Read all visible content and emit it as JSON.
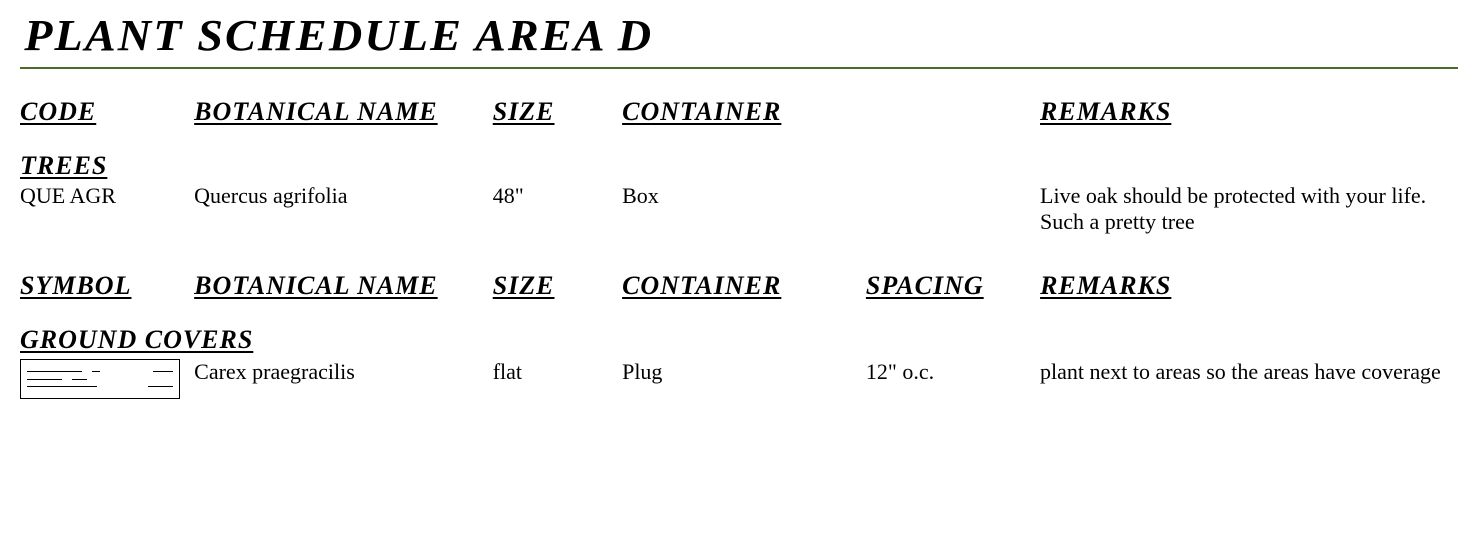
{
  "title": "PLANT SCHEDULE AREA D",
  "section1": {
    "headers": {
      "code": "CODE",
      "botanical": "BOTANICAL NAME",
      "size": "SIZE",
      "container": "CONTAINER",
      "remarks": "REMARKS"
    },
    "category": "TREES",
    "rows": [
      {
        "code": "QUE AGR",
        "botanical": "Quercus agrifolia",
        "size": "48\"",
        "container": "Box",
        "remarks": "Live oak should be protected with your life. Such a pretty tree"
      }
    ]
  },
  "section2": {
    "headers": {
      "symbol": "SYMBOL",
      "botanical": "BOTANICAL NAME",
      "size": "SIZE",
      "container": "CONTAINER",
      "spacing": "SPACING",
      "remarks": "REMARKS"
    },
    "category": "GROUND COVERS",
    "rows": [
      {
        "botanical": "Carex praegracilis",
        "size": "flat",
        "container": "Plug",
        "spacing": "12\" o.c.",
        "remarks": "plant next to areas so the areas have coverage"
      }
    ]
  }
}
